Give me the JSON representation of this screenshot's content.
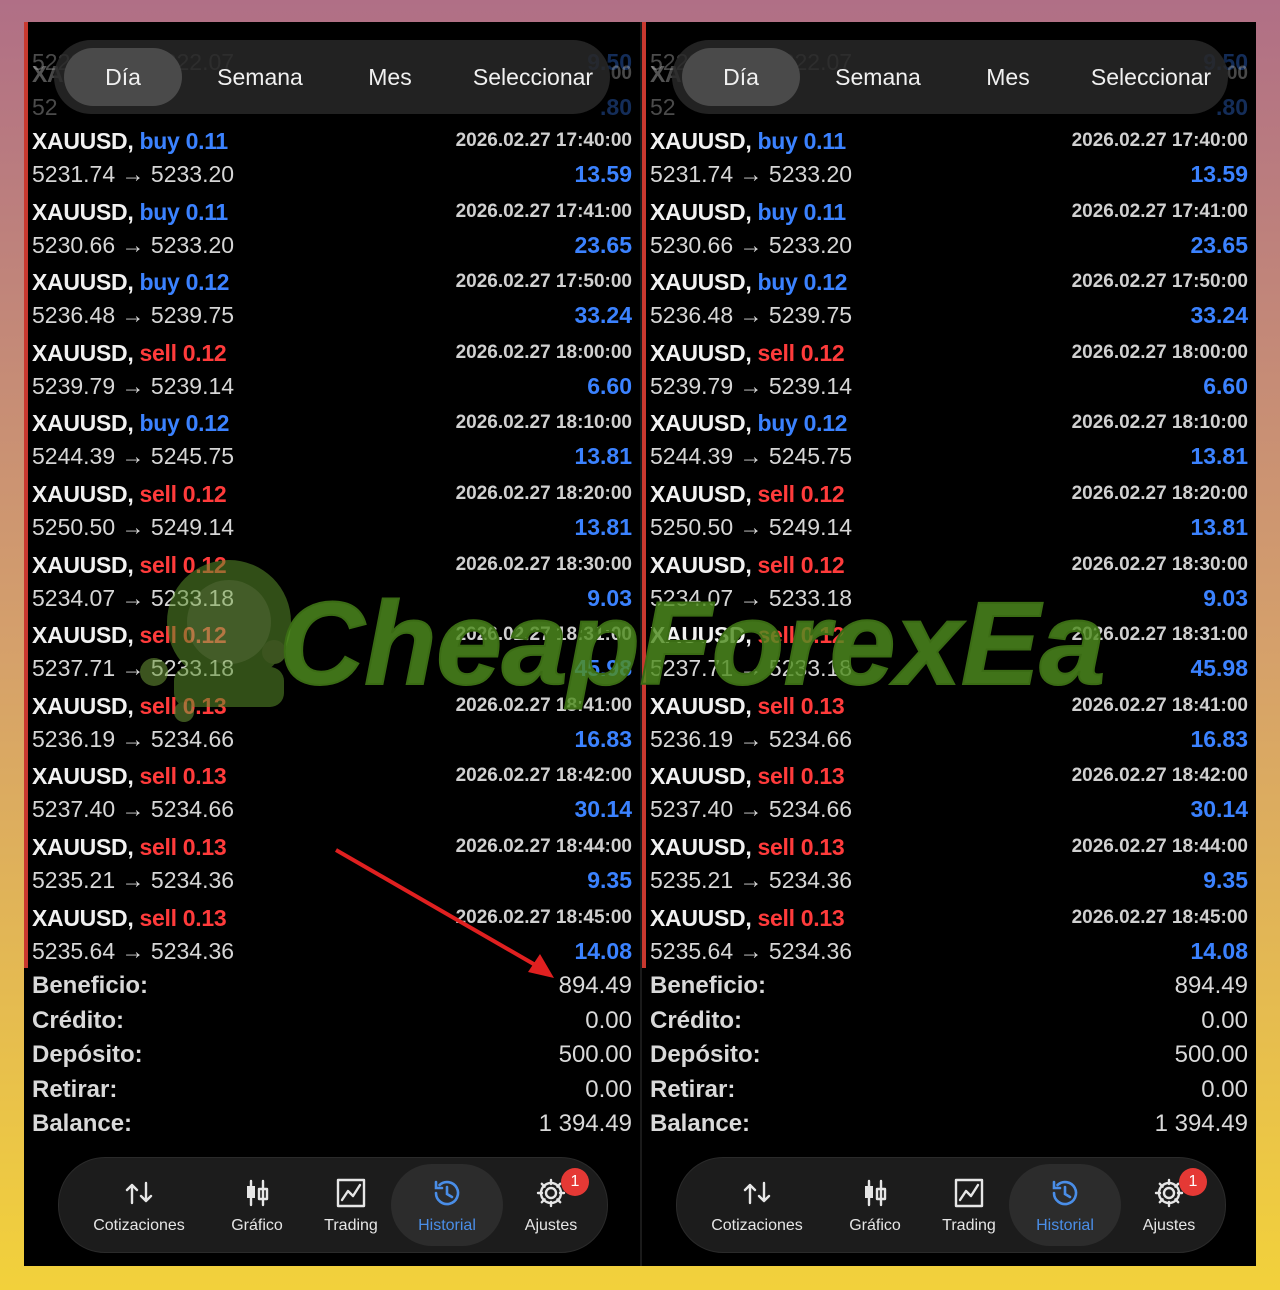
{
  "tabs": [
    {
      "label": "Día",
      "active": true
    },
    {
      "label": "Semana",
      "active": false
    },
    {
      "label": "Mes",
      "active": false
    },
    {
      "label": "Seleccionar",
      "active": false
    }
  ],
  "ghost_rows": {
    "top_prices": "5223.09 → 5222.07",
    "top_profit": "9.50",
    "partial_symbol": "XA",
    "partial_price": "52",
    "partial_time_end": "00",
    "partial_profit": ".80"
  },
  "trades": [
    {
      "symbol": "XAUUSD,",
      "side": "buy",
      "volume": "0.11",
      "time": "2026.02.27 17:40:00",
      "prices": "5231.74 → 5233.20",
      "profit": "13.59"
    },
    {
      "symbol": "XAUUSD,",
      "side": "buy",
      "volume": "0.11",
      "time": "2026.02.27 17:41:00",
      "prices": "5230.66 → 5233.20",
      "profit": "23.65"
    },
    {
      "symbol": "XAUUSD,",
      "side": "buy",
      "volume": "0.12",
      "time": "2026.02.27 17:50:00",
      "prices": "5236.48 → 5239.75",
      "profit": "33.24"
    },
    {
      "symbol": "XAUUSD,",
      "side": "sell",
      "volume": "0.12",
      "time": "2026.02.27 18:00:00",
      "prices": "5239.79 → 5239.14",
      "profit": "6.60"
    },
    {
      "symbol": "XAUUSD,",
      "side": "buy",
      "volume": "0.12",
      "time": "2026.02.27 18:10:00",
      "prices": "5244.39 → 5245.75",
      "profit": "13.81"
    },
    {
      "symbol": "XAUUSD,",
      "side": "sell",
      "volume": "0.12",
      "time": "2026.02.27 18:20:00",
      "prices": "5250.50 → 5249.14",
      "profit": "13.81"
    },
    {
      "symbol": "XAUUSD,",
      "side": "sell",
      "volume": "0.12",
      "time": "2026.02.27 18:30:00",
      "prices": "5234.07 → 5233.18",
      "profit": "9.03"
    },
    {
      "symbol": "XAUUSD,",
      "side": "sell",
      "volume": "0.12",
      "time": "2026.02.27 18:31:00",
      "prices": "5237.71 → 5233.18",
      "profit": "45.98"
    },
    {
      "symbol": "XAUUSD,",
      "side": "sell",
      "volume": "0.13",
      "time": "2026.02.27 18:41:00",
      "prices": "5236.19 → 5234.66",
      "profit": "16.83"
    },
    {
      "symbol": "XAUUSD,",
      "side": "sell",
      "volume": "0.13",
      "time": "2026.02.27 18:42:00",
      "prices": "5237.40 → 5234.66",
      "profit": "30.14"
    },
    {
      "symbol": "XAUUSD,",
      "side": "sell",
      "volume": "0.13",
      "time": "2026.02.27 18:44:00",
      "prices": "5235.21 → 5234.36",
      "profit": "9.35"
    },
    {
      "symbol": "XAUUSD,",
      "side": "sell",
      "volume": "0.13",
      "time": "2026.02.27 18:45:00",
      "prices": "5235.64 → 5234.36",
      "profit": "14.08"
    }
  ],
  "summary": [
    {
      "label": "Beneficio:",
      "value": "894.49"
    },
    {
      "label": "Crédito:",
      "value": "0.00"
    },
    {
      "label": "Depósito:",
      "value": "500.00"
    },
    {
      "label": "Retirar:",
      "value": "0.00"
    },
    {
      "label": "Balance:",
      "value": "1 394.49"
    }
  ],
  "nav": [
    {
      "label": "Cotizaciones",
      "icon": "quotes-arrows-icon",
      "active": false
    },
    {
      "label": "Gráfico",
      "icon": "candlestick-chart-icon",
      "active": false
    },
    {
      "label": "Trading",
      "icon": "trading-line-chart-icon",
      "active": false
    },
    {
      "label": "Historial",
      "icon": "history-clock-icon",
      "active": true
    },
    {
      "label": "Ajustes",
      "icon": "gear-icon",
      "active": false,
      "badge": "1"
    }
  ],
  "watermark_text": "CheapForexEa",
  "colors": {
    "buy": "#3b82ff",
    "sell": "#ff3b3b",
    "profit": "#3b82ff",
    "accent": "#c8382f",
    "active_nav": "#4a8ee8",
    "badge": "#e53935",
    "watermark": "#4e8c1e"
  }
}
